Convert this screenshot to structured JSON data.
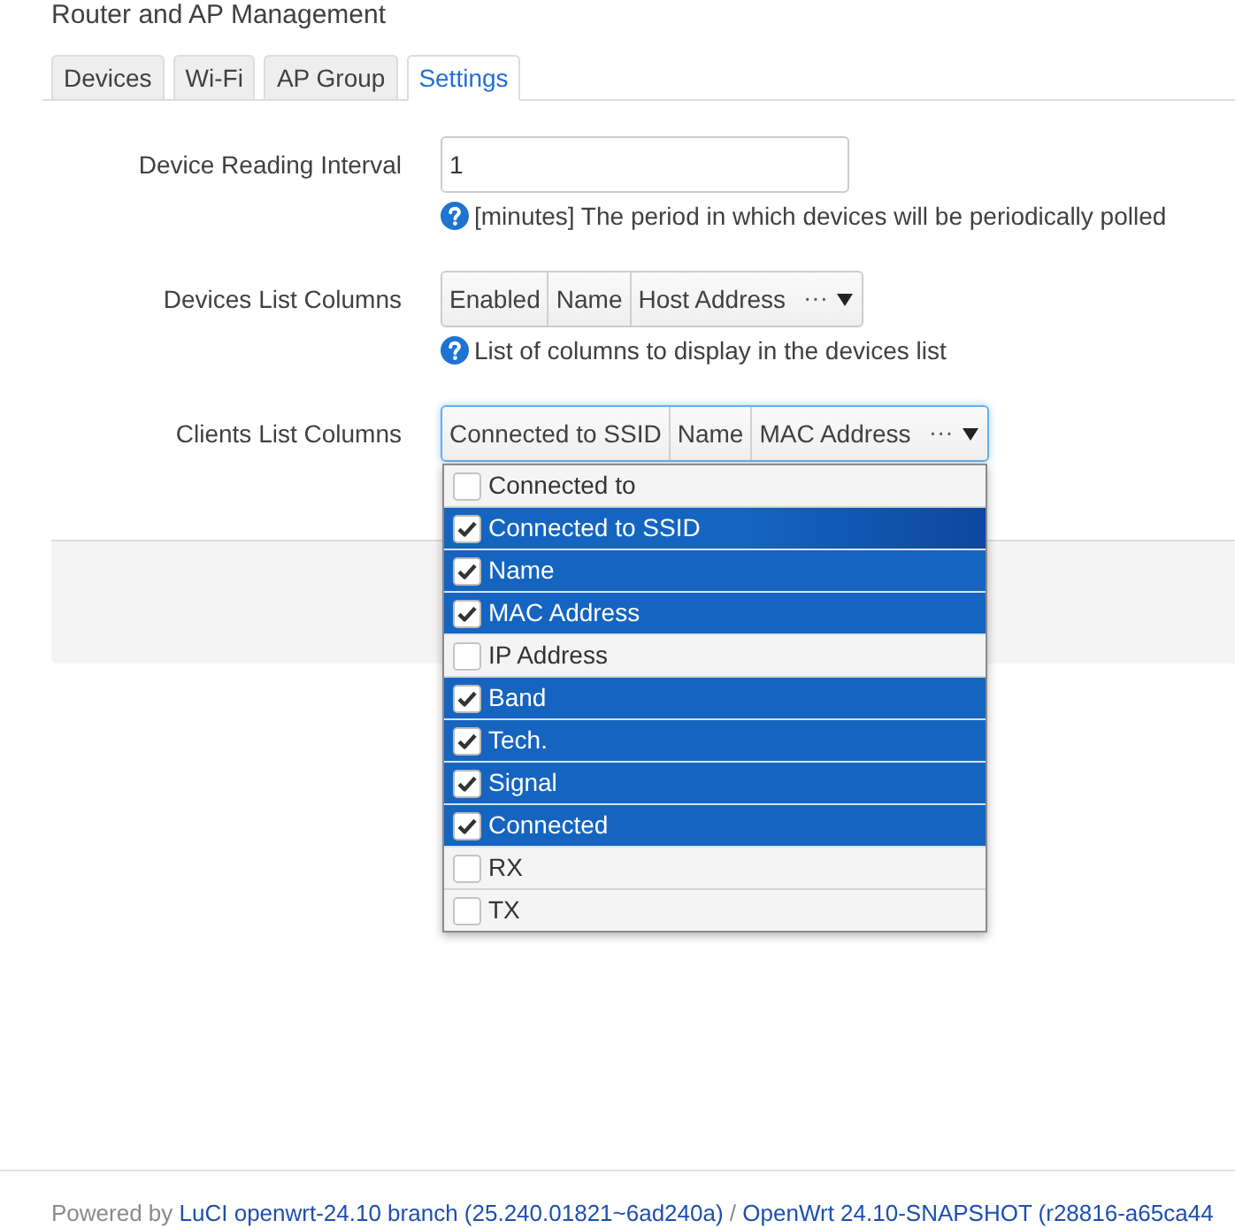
{
  "header": {
    "title": "Router and AP Management"
  },
  "tabs": [
    {
      "label": "Devices",
      "selected": false
    },
    {
      "label": "Wi-Fi",
      "selected": false
    },
    {
      "label": "AP Group",
      "selected": false
    },
    {
      "label": "Settings",
      "selected": true
    }
  ],
  "fields": [
    {
      "kind": "text",
      "label": "Device Reading Interval",
      "value": "1",
      "help": "[minutes] The period in which devices will be periodically polled"
    },
    {
      "kind": "multiselect",
      "label": "Devices List Columns",
      "chosen": [
        "Enabled",
        "Name",
        "Host Address"
      ],
      "more": "···",
      "focused": false,
      "help": "List of columns to display in the devices list"
    },
    {
      "kind": "multiselect",
      "label": "Clients List Columns",
      "chosen": [
        "Connected to SSID",
        "Name",
        "MAC Address"
      ],
      "more": "···",
      "focused": true,
      "expanded": true,
      "options": [
        {
          "label": "Connected to",
          "checked": false,
          "highlighted": false
        },
        {
          "label": "Connected to SSID",
          "checked": true,
          "highlighted": true
        },
        {
          "label": "Name",
          "checked": true,
          "highlighted": false
        },
        {
          "label": "MAC Address",
          "checked": true,
          "highlighted": false
        },
        {
          "label": "IP Address",
          "checked": false,
          "highlighted": false
        },
        {
          "label": "Band",
          "checked": true,
          "highlighted": false
        },
        {
          "label": "Tech.",
          "checked": true,
          "highlighted": false
        },
        {
          "label": "Signal",
          "checked": true,
          "highlighted": false
        },
        {
          "label": "Connected",
          "checked": true,
          "highlighted": false
        },
        {
          "label": "RX",
          "checked": false,
          "highlighted": false
        },
        {
          "label": "TX",
          "checked": false,
          "highlighted": false
        }
      ]
    }
  ],
  "footer": {
    "prefix": "Powered by",
    "links": [
      "LuCI openwrt-24.10 branch (25.240.01821~6ad240a)",
      "OpenWrt 24.10-SNAPSHOT (r28816-a65ca44"
    ],
    "separator": "/"
  }
}
